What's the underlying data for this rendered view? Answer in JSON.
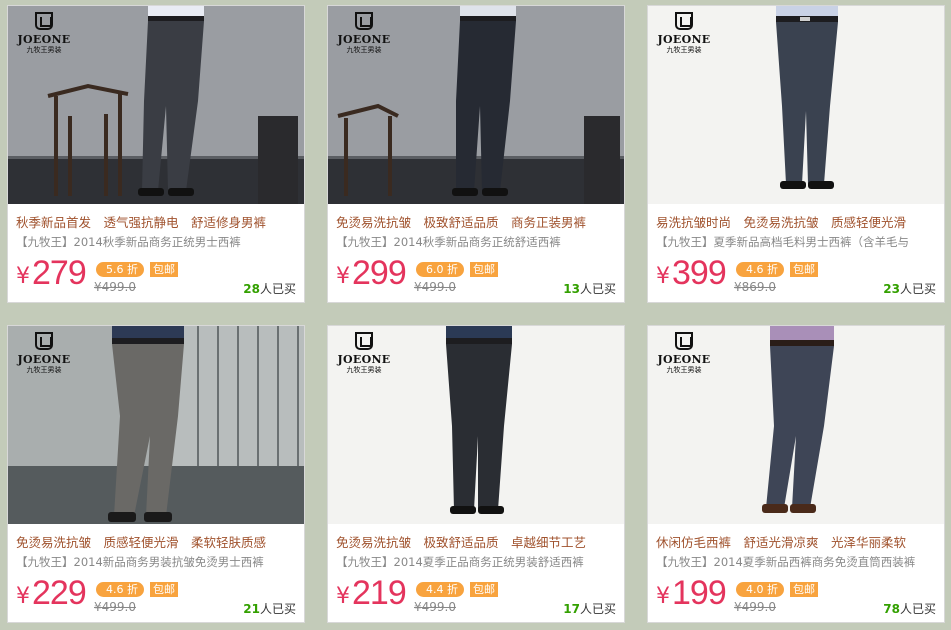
{
  "brand": {
    "name": "JOEONE",
    "sub": "九牧王男装"
  },
  "products": [
    {
      "features": "秋季新品首发　透气强抗静电　舒适修身男裤",
      "title": "【九牧王】2014秋季新品商务正统男士西裤",
      "currency": "¥",
      "price": "279",
      "discount": "5.6 折",
      "badge": "包邮",
      "orig_price": "¥499.0",
      "sold_count": "28",
      "sold_suffix": "人已买",
      "photo": "gray-wall-chair"
    },
    {
      "features": "免烫易洗抗皱　极致舒适品质　商务正装男裤",
      "title": "【九牧王】2014秋季新品商务正统舒适西裤",
      "currency": "¥",
      "price": "299",
      "discount": "6.0 折",
      "badge": "包邮",
      "orig_price": "¥499.0",
      "sold_count": "13",
      "sold_suffix": "人已买",
      "photo": "gray-wall-chair"
    },
    {
      "features": "易洗抗皱时尚　免烫易洗抗皱　质感轻便光滑",
      "title": "【九牧王】夏季新品高档毛料男士西裤（含羊毛与",
      "currency": "¥",
      "price": "399",
      "discount": "4.6 折",
      "badge": "包邮",
      "orig_price": "¥869.0",
      "sold_count": "23",
      "sold_suffix": "人已买",
      "photo": "plain-light"
    },
    {
      "features": "免烫易洗抗皱　质感轻便光滑　柔软轻肤质感",
      "title": "【九牧王】2014新品商务男装抗皱免烫男士西裤",
      "currency": "¥",
      "price": "229",
      "discount": "4.6 折",
      "badge": "包邮",
      "orig_price": "¥499.0",
      "sold_count": "21",
      "sold_suffix": "人已买",
      "photo": "gray-wall-stripes"
    },
    {
      "features": "免烫易洗抗皱　极致舒适品质　卓越细节工艺",
      "title": "【九牧王】2014夏季正品商务正统男装舒适西裤",
      "currency": "¥",
      "price": "219",
      "discount": "4.4 折",
      "badge": "包邮",
      "orig_price": "¥499.0",
      "sold_count": "17",
      "sold_suffix": "人已买",
      "photo": "plain-light"
    },
    {
      "features": "休闲仿毛西裤　舒适光滑凉爽　光泽华丽柔软",
      "title": "【九牧王】2014夏季新品西裤商务免烫直筒西装裤",
      "currency": "¥",
      "price": "199",
      "discount": "4.0 折",
      "badge": "包邮",
      "orig_price": "¥499.0",
      "sold_count": "78",
      "sold_suffix": "人已买",
      "photo": "plain-light"
    }
  ],
  "colors": {
    "page_bg": "#c3cbb9",
    "price": "#e4345d",
    "features": "#a0522d",
    "badge": "#f8a33e",
    "sold": "#33a000"
  }
}
